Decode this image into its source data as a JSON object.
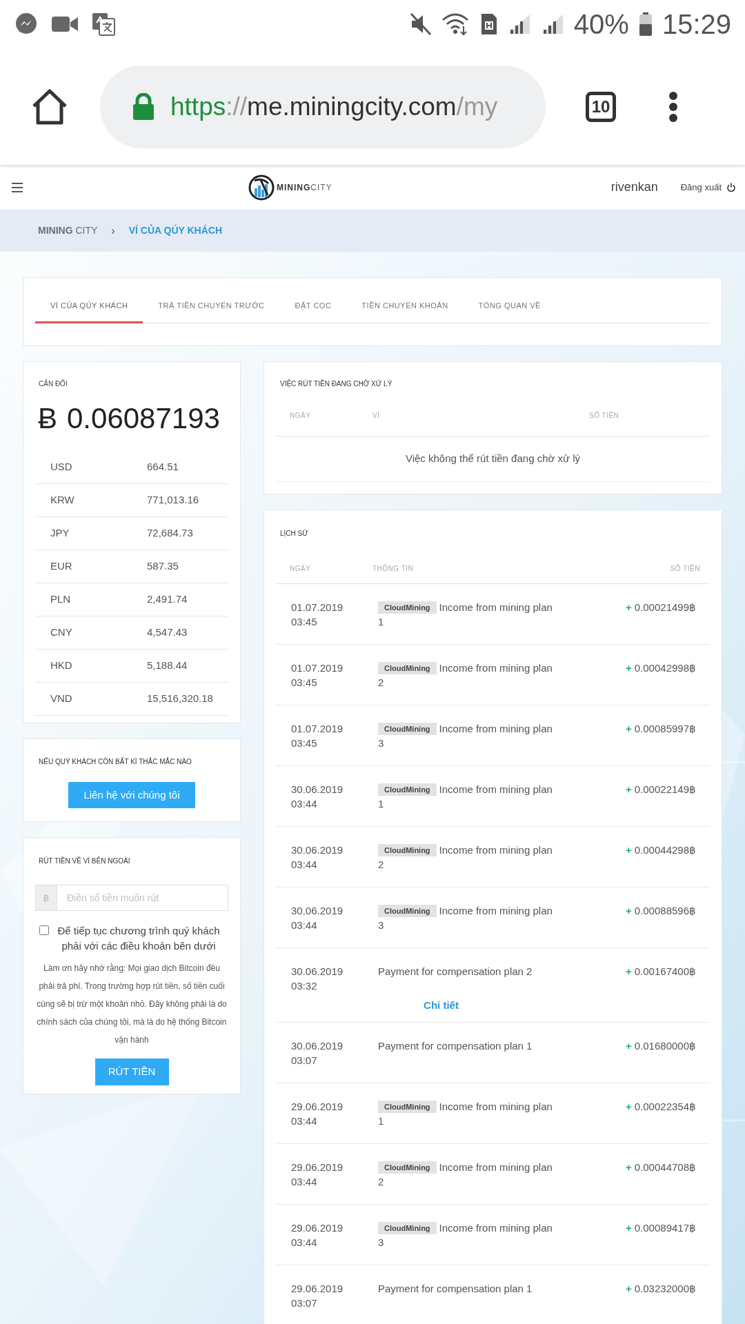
{
  "status_bar": {
    "battery_text": "40%",
    "time": "15:29"
  },
  "browser": {
    "url_parts": [
      {
        "kind": "scheme",
        "text": "https"
      },
      {
        "kind": "separator",
        "text": "://"
      },
      {
        "kind": "host",
        "text": "me.miningcity.com"
      },
      {
        "kind": "path",
        "text": "/my"
      }
    ],
    "tab_count": "10"
  },
  "site_header": {
    "logo_bold": "MINING",
    "logo_light": "CITY",
    "username": "rivenkan",
    "logout": "Đăng xuất"
  },
  "breadcrumb": {
    "items": [
      "**MINING** CITY",
      "VÍ CỦA QÚY KHÁCH"
    ],
    "separator": "›"
  },
  "tabs": [
    {
      "label": "VÍ CỦA QÚY KHÁCH",
      "selected": true
    },
    {
      "label": "TRẢ TIỀN CHUYỂN TRƯỚC",
      "selected": false
    },
    {
      "label": "ĐẶT CỌC",
      "selected": false
    },
    {
      "label": "TIỀN CHUYỂN KHOẢN",
      "selected": false
    },
    {
      "label": "TỔNG QUAN VỀ",
      "selected": false
    }
  ],
  "balance": {
    "title": "CÂN ĐỐI",
    "symbol": "Ƀ",
    "amount": "0.06087193",
    "currencies": [
      {
        "code": "USD",
        "value": "664.51"
      },
      {
        "code": "KRW",
        "value": "771,013.16"
      },
      {
        "code": "JPY",
        "value": "72,684.73"
      },
      {
        "code": "EUR",
        "value": "587.35"
      },
      {
        "code": "PLN",
        "value": "2,491.74"
      },
      {
        "code": "CNY",
        "value": "4,547.43"
      },
      {
        "code": "HKD",
        "value": "5,188.44"
      },
      {
        "code": "VND",
        "value": "15,516,320.18"
      }
    ]
  },
  "contact": {
    "title": "NẾU QUÝ KHÁCH CÒN BẤT KÌ THẮC MẮC NÀO",
    "button": "Liên hệ với chúng tôi"
  },
  "withdraw": {
    "title": "RÚT TIỀN VỀ VÍ BÊN NGOÀI",
    "prefix": "฿",
    "placeholder": "Điền số tiền muốn rút",
    "agree_checked": false,
    "agree_label": "Để tiếp tục chương trình quý khách phải với các điều khoản bên dưới",
    "note": "Làm ơn hãy nhớ rằng: Mọi giao dịch Bitcoin đều phải trả phí. Trong trường hợp rút tiền, số tiền cuối cùng sẽ bị trừ một khoản nhỏ. Đây không phải là do chính sách của chúng tôi, mà là do hệ thống Bitcoin vận hành",
    "button": "RÚT TIỀN"
  },
  "pending": {
    "title": "VIỆC RÚT TIỀN ĐANG CHỜ XỬ LÝ",
    "columns": [
      "NGÀY",
      "VÍ",
      "SỐ TIỀN"
    ],
    "empty_message": "Việc không thể rút tiền đang chờ xử lý"
  },
  "history": {
    "title": "LỊCH SỬ",
    "columns": [
      "NGÀY",
      "THÔNG TIN",
      "SỐ TIỀN"
    ],
    "rows": [
      {
        "date": "01.07.2019",
        "time": "03:45",
        "tag": "CloudMining",
        "info": "Income from mining plan 1",
        "sign": "+",
        "amount": "0.00021499฿"
      },
      {
        "date": "01.07.2019",
        "time": "03:45",
        "tag": "CloudMining",
        "info": "Income from mining plan 2",
        "sign": "+",
        "amount": "0.00042998฿"
      },
      {
        "date": "01.07.2019",
        "time": "03:45",
        "tag": "CloudMining",
        "info": "Income from mining plan 3",
        "sign": "+",
        "amount": "0.00085997฿"
      },
      {
        "date": "30.06.2019",
        "time": "03:44",
        "tag": "CloudMining",
        "info": "Income from mining plan 1",
        "sign": "+",
        "amount": "0.00022149฿"
      },
      {
        "date": "30.06.2019",
        "time": "03:44",
        "tag": "CloudMining",
        "info": "Income from mining plan 2",
        "sign": "+",
        "amount": "0.00044298฿"
      },
      {
        "date": "30.06.2019",
        "time": "03:44",
        "tag": "CloudMining",
        "info": "Income from mining plan 3",
        "sign": "+",
        "amount": "0.00088596฿"
      },
      {
        "date": "30.06.2019",
        "time": "03:32",
        "info": "Payment for compensation plan 2",
        "sign": "+",
        "amount": "0.00167400฿",
        "link": "Chi tiết"
      },
      {
        "date": "30.06.2019",
        "time": "03:07",
        "info": "Payment for compensation plan 1",
        "sign": "+",
        "amount": "0.01680000฿"
      },
      {
        "date": "29.06.2019",
        "time": "03:44",
        "tag": "CloudMining",
        "info": "Income from mining plan 1",
        "sign": "+",
        "amount": "0.00022354฿"
      },
      {
        "date": "29.06.2019",
        "time": "03:44",
        "tag": "CloudMining",
        "info": "Income from mining plan 2",
        "sign": "+",
        "amount": "0.00044708฿"
      },
      {
        "date": "29.06.2019",
        "time": "03:44",
        "tag": "CloudMining",
        "info": "Income from mining plan 3",
        "sign": "+",
        "amount": "0.00089417฿"
      },
      {
        "date": "29.06.2019",
        "time": "03:07",
        "info": "Payment for compensation plan 1",
        "sign": "+",
        "amount": "0.03232000฿"
      }
    ]
  }
}
